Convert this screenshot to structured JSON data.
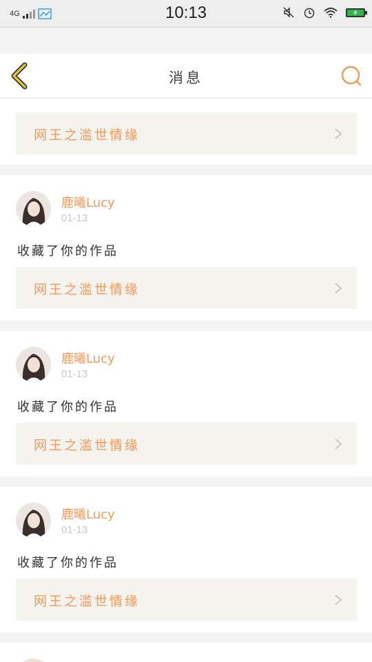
{
  "status_bar": {
    "network": "4G",
    "time": "10:13"
  },
  "header": {
    "title": "消息"
  },
  "colors": {
    "accent": "#f09a5c",
    "chevron": "#c8c8c8",
    "back_arrow": "#e2c33f"
  },
  "messages": [
    {
      "work_title": "网王之滥世情缘"
    },
    {
      "user": "鹿曦Lucy",
      "date": "01-13",
      "action": "收藏了你的作品",
      "work_title": "网王之滥世情缘"
    },
    {
      "user": "鹿曦Lucy",
      "date": "01-13",
      "action": "收藏了你的作品",
      "work_title": "网王之滥世情缘"
    },
    {
      "user": "鹿曦Lucy",
      "date": "01-13",
      "action": "收藏了你的作品",
      "work_title": "网王之滥世情缘"
    }
  ]
}
